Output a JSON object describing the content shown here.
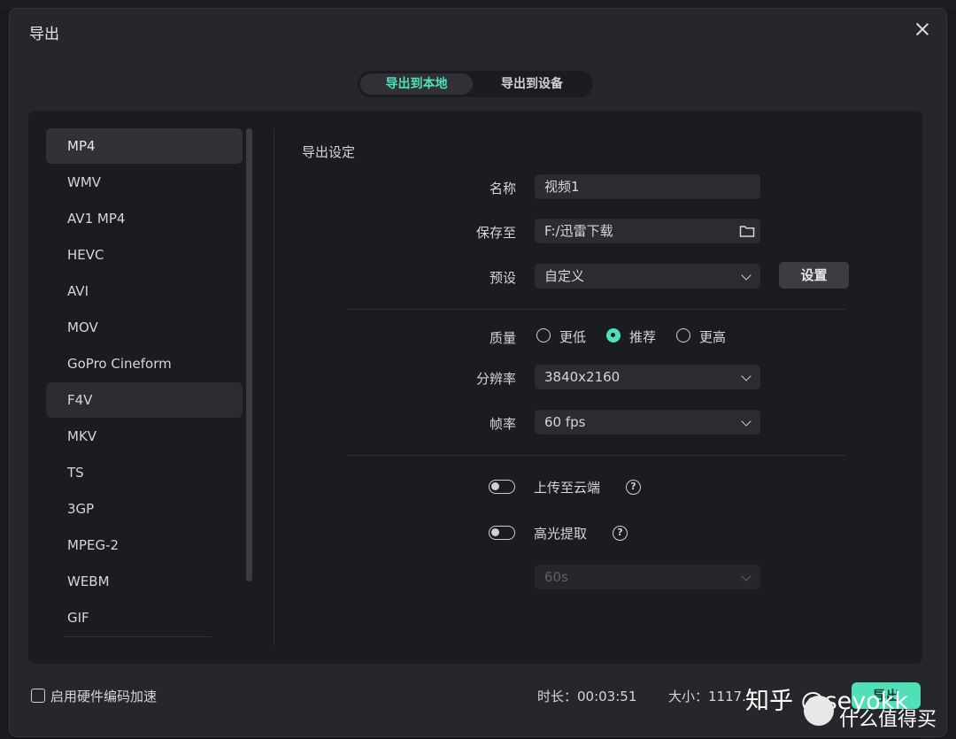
{
  "dialog": {
    "title": "导出",
    "tabs": [
      {
        "label": "导出到本地",
        "active": true
      },
      {
        "label": "导出到设备",
        "active": false
      }
    ]
  },
  "formats": [
    "MP4",
    "WMV",
    "AV1 MP4",
    "HEVC",
    "AVI",
    "MOV",
    "GoPro Cineform",
    "F4V",
    "MKV",
    "TS",
    "3GP",
    "MPEG-2",
    "WEBM",
    "GIF"
  ],
  "selected_format": "MP4",
  "settings": {
    "section_title": "导出设定",
    "name_label": "名称",
    "name_value": "视频1",
    "save_label": "保存至",
    "save_value": "F:/迅雷下载",
    "preset_label": "预设",
    "preset_value": "自定义",
    "preset_button": "设置",
    "quality_label": "质量",
    "quality_options": [
      "更低",
      "推荐",
      "更高"
    ],
    "quality_selected": "推荐",
    "resolution_label": "分辨率",
    "resolution_value": "3840x2160",
    "fps_label": "帧率",
    "fps_value": "60 fps",
    "upload_label": "上传至云端",
    "highlight_label": "高光提取",
    "highlight_duration": "60s"
  },
  "footer": {
    "hw_accel_label": "启用硬件编码加速",
    "duration_label": "时长：00:03:51",
    "size_label": "大小：1117.",
    "export_button": "导出"
  },
  "watermark": {
    "line1": "知乎 @seyokk",
    "line2": "什么值得买"
  },
  "colors": {
    "accent": "#4fe0b8",
    "panel": "#1b1c1f",
    "dialog": "#26272b"
  }
}
